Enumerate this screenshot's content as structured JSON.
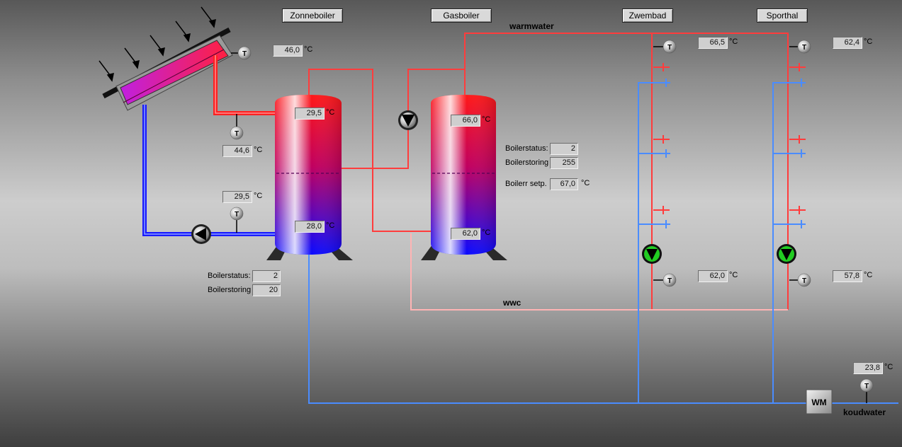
{
  "nav": [
    "Zonneboiler",
    "Gasboiler",
    "Zwembad",
    "Sporthal"
  ],
  "pipe_labels": {
    "warmwater": "warmwater",
    "wwc": "wwc",
    "koudwater": "koudwater"
  },
  "meter_label": "WM",
  "sensor_letter": "T",
  "unit": "°C",
  "temps": {
    "collector": "46,0",
    "collector_return": "44,6",
    "solar_return": "29,5",
    "zonneboiler_top": "29,5",
    "zonneboiler_bottom": "28,0",
    "gasboiler_top": "66,0",
    "gasboiler_bottom": "62,0",
    "zwembad_supply": "66,5",
    "zwembad_return": "62,0",
    "sporthal_supply": "62,4",
    "sporthal_return": "57,8",
    "koudwater": "23,8"
  },
  "zonneboiler_status": {
    "status_label": "Boilerstatus:",
    "status_value": "2",
    "storing_label": "Boilerstoring",
    "storing_value": "20"
  },
  "gasboiler_status": {
    "status_label": "Boilerstatus:",
    "status_value": "2",
    "storing_label": "Boilerstoring",
    "storing_value": "255",
    "setp_label": "Boilerr setp.",
    "setp_value": "67,0"
  },
  "colors": {
    "hot_pipe": "#ff3c3c",
    "cold_pipe": "#4a8cff",
    "solar_pipe": "#1a1aff",
    "pump_active": "#22cc22",
    "wwc_pipe": "#ffb4b4"
  }
}
